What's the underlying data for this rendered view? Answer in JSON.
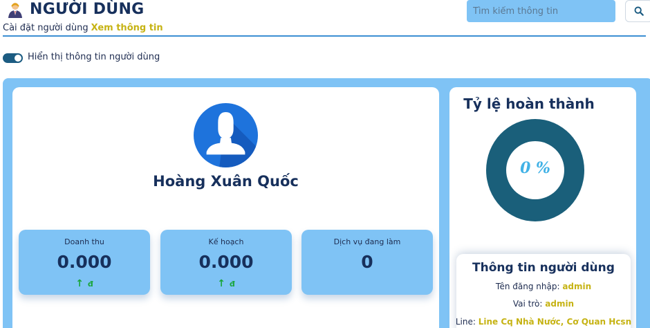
{
  "header": {
    "title": "NGƯỜI DÙNG",
    "breadcrumb_text": "Cài đặt người dùng",
    "breadcrumb_link": "Xem thông tin"
  },
  "search": {
    "placeholder": "Tìm kiếm thông tin",
    "icon": "search-icon"
  },
  "toggle": {
    "label": "Hiển thị thông tin người dùng",
    "checked": true
  },
  "profile": {
    "name": "Hoàng Xuân Quốc",
    "avatar_icon": "user-avatar-icon"
  },
  "stats": [
    {
      "label": "Doanh thu",
      "value": "0.000",
      "unit": "đ",
      "trend_icon": "arrow-up-icon"
    },
    {
      "label": "Kế hoạch",
      "value": "0.000",
      "unit": "đ",
      "trend_icon": "arrow-up-icon"
    },
    {
      "label": "Dịch vụ đang làm",
      "value": "0"
    }
  ],
  "completion": {
    "title": "Tỷ lệ hoàn thành",
    "percent_label": "0 %",
    "percent": 0
  },
  "user_info": {
    "title": "Thông tin người dùng",
    "username_label": "Tên đăng nhập:",
    "username": "admin",
    "role_label": "Vai trò:",
    "role": "admin",
    "line_label": "Line:",
    "line": "Line Cq Nhà Nước, Cơ Quan Hcsn"
  },
  "colors": {
    "panel": "#7fc3f5",
    "accent_text": "#c6b314",
    "donut_ring": "#1a5f7a",
    "title": "#17305c"
  }
}
